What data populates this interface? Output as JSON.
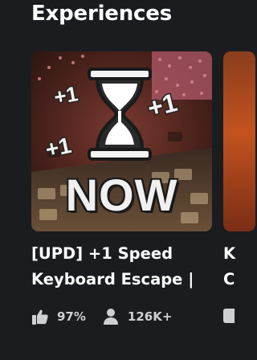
{
  "section": {
    "title": "Experiences"
  },
  "card": {
    "thumbnail_text": "NOW",
    "plus_one_text": "+1",
    "name_line1": "[UPD] +1 Speed",
    "name_line2": "Keyboard Escape |",
    "rating": "97%",
    "players": "126K+",
    "thumb_icon": "hourglass-icon"
  },
  "next_card": {
    "name_line1": "K",
    "name_line2": "C"
  },
  "colors": {
    "background": "#1b1c20",
    "text": "#ffffff",
    "stat_text": "#cfd0d4"
  }
}
